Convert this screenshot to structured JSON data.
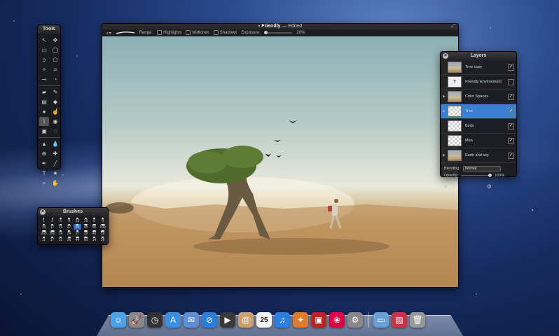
{
  "tools_panel": {
    "title": "Tools",
    "tools": [
      "arrow-icon",
      "move-icon",
      "rect-select-icon",
      "ellipse-select-icon",
      "lasso-icon",
      "poly-lasso-icon",
      "magic-wand-icon",
      "crop-icon",
      "eyedropper-icon",
      "color-picker-icon",
      "eraser-icon",
      "pencil-icon",
      "gradient-icon",
      "bucket-icon",
      "paint-icon",
      "smudge-icon",
      "brush-icon",
      "burn-icon",
      "sponge-icon",
      "dodge-icon",
      "sharpen-icon",
      "blur-icon",
      "clone-icon",
      "heal-icon",
      "pen-icon",
      "line-icon",
      "text-icon",
      "shape-icon",
      "zoom-icon",
      "hand-icon"
    ]
  },
  "main_window": {
    "title_name": "Friendly",
    "title_status": "— Edited",
    "toolbar": {
      "range_label": "Range:",
      "highlights_label": "Highlights",
      "midtones_label": "Midtones",
      "shadows_label": "Shadows",
      "exposure_label": "Exposure:",
      "exposure_value": "20%"
    }
  },
  "layers_panel": {
    "title": "Layers",
    "layers": [
      {
        "name": "Tree copy",
        "thumb": "photo",
        "visible": true
      },
      {
        "name": "Friendly Environment",
        "thumb": "text",
        "visible": false
      },
      {
        "name": "Color Spaces",
        "thumb": "photo",
        "visible": true
      },
      {
        "name": "Tree",
        "thumb": "checker",
        "visible": true,
        "selected": true
      },
      {
        "name": "Birds",
        "thumb": "checker",
        "visible": true
      },
      {
        "name": "Man",
        "thumb": "checker",
        "visible": true
      },
      {
        "name": "Earth and sky",
        "thumb": "photo",
        "visible": true
      }
    ],
    "blending_label": "Blending:",
    "blending_value": "Normal",
    "opacity_label": "Opacity:",
    "opacity_value": "100%"
  },
  "brushes_panel": {
    "title": "Brushes",
    "brushes": [
      {
        "size": "1"
      },
      {
        "size": "3"
      },
      {
        "size": "5"
      },
      {
        "size": "9"
      },
      {
        "size": "13"
      },
      {
        "size": "19"
      },
      {
        "size": "5"
      },
      {
        "size": "9"
      },
      {
        "size": "13"
      },
      {
        "size": "17"
      },
      {
        "size": "21"
      },
      {
        "size": "27"
      },
      {
        "size": "35"
      },
      {
        "size": "45"
      },
      {
        "size": "65"
      },
      {
        "size": "100"
      },
      {
        "size": "200"
      },
      {
        "size": "300"
      },
      {
        "size": "14"
      },
      {
        "size": "24"
      },
      {
        "size": "27"
      },
      {
        "size": "39"
      },
      {
        "size": "46"
      },
      {
        "size": "59"
      },
      {
        "size": "11"
      },
      {
        "size": "17"
      },
      {
        "size": "23"
      },
      {
        "size": "36"
      },
      {
        "size": "44"
      },
      {
        "size": "60"
      },
      {
        "size": "14"
      },
      {
        "size": "26"
      }
    ]
  },
  "dock": {
    "items": [
      "finder-icon",
      "launchpad-icon",
      "dashboard-icon",
      "app-store-icon",
      "mail-icon",
      "safari-icon",
      "facetime-icon",
      "contacts-icon",
      "calendar-icon",
      "itunes-icon",
      "pixelmator-icon",
      "photo-booth-icon",
      "iphoto-icon",
      "system-preferences-icon",
      "folder-icon",
      "photos-icon",
      "trash-icon"
    ],
    "calendar_day": "25"
  },
  "colors": {
    "accent": "#3a7fd6",
    "panel_bg": "#1c1c1e",
    "desktop": "#152a5e"
  }
}
